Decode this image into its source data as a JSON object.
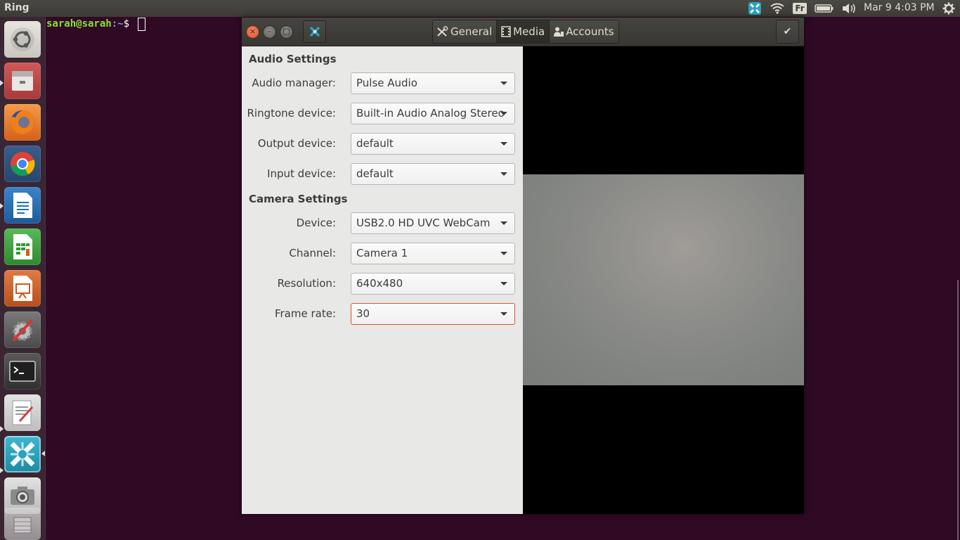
{
  "top_panel": {
    "app_title": "Ring",
    "keyboard_layout": "Fr",
    "clock": "Mar  9  4:03 PM"
  },
  "launcher": {
    "items": [
      {
        "name": "ubuntu-dash",
        "color": "#d9d5cf"
      },
      {
        "name": "files",
        "color": "#c24b4b"
      },
      {
        "name": "firefox",
        "color": "#e66000"
      },
      {
        "name": "chrome",
        "color": "#4285f4"
      },
      {
        "name": "writer",
        "color": "#1d70b8"
      },
      {
        "name": "calc",
        "color": "#2e9a2e"
      },
      {
        "name": "impress",
        "color": "#c75a24"
      },
      {
        "name": "system-settings",
        "color": "#666666"
      },
      {
        "name": "terminal",
        "color": "#2c2c2c"
      },
      {
        "name": "text-editor",
        "color": "#dcdcdc"
      },
      {
        "name": "ring",
        "color": "#2aa2bd"
      },
      {
        "name": "camera",
        "color": "#cfcfcf"
      }
    ]
  },
  "terminal": {
    "user": "sarah@sarah",
    "path": ":~",
    "symbol": "$"
  },
  "window": {
    "tabs": [
      {
        "label": "General",
        "icon": "tools-icon",
        "active": false
      },
      {
        "label": "Media",
        "icon": "film-icon",
        "active": true
      },
      {
        "label": "Accounts",
        "icon": "people-icon",
        "active": false
      }
    ],
    "close_glyph": "×",
    "minimize_glyph": "–",
    "maximize_glyph": "□",
    "apply_glyph": "✔"
  },
  "audio_settings": {
    "title": "Audio Settings",
    "fields": [
      {
        "label": "Audio manager:",
        "value": "Pulse Audio"
      },
      {
        "label": "Ringtone device:",
        "value": "Built-in Audio Analog Stereo"
      },
      {
        "label": "Output device:",
        "value": "default"
      },
      {
        "label": "Input device:",
        "value": "default"
      }
    ]
  },
  "camera_settings": {
    "title": "Camera Settings",
    "fields": [
      {
        "label": "Device:",
        "value": "USB2.0 HD UVC WebCam"
      },
      {
        "label": "Channel:",
        "value": "Camera 1"
      },
      {
        "label": "Resolution:",
        "value": "640x480"
      },
      {
        "label": "Frame rate:",
        "value": "30"
      }
    ]
  },
  "colors": {
    "desktop": "#300a24",
    "accent": "#d8542f",
    "panel": "#e8e8e7"
  }
}
